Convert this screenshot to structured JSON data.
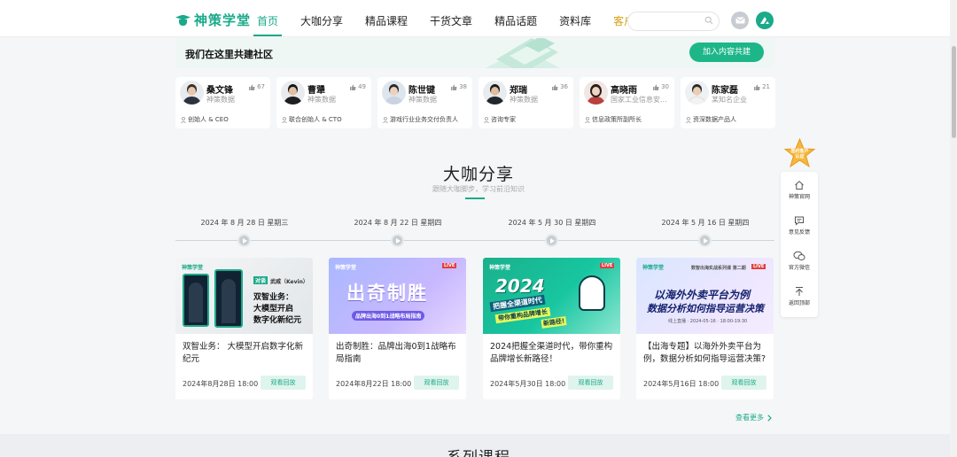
{
  "header": {
    "logo_text": "神策学堂",
    "nav": [
      {
        "label": "首页",
        "active": true
      },
      {
        "label": "大咖分享"
      },
      {
        "label": "精品课程"
      },
      {
        "label": "干货文章"
      },
      {
        "label": "精品话题"
      },
      {
        "label": "资料库"
      },
      {
        "label": "客户专区",
        "vip": true
      }
    ],
    "search_placeholder": ""
  },
  "community": {
    "title": "我们在这里共建社区",
    "join_label": "加入内容共建"
  },
  "members": [
    {
      "name": "桑文锋",
      "likes": "67",
      "org": "神策数据",
      "role": "创始人 & CEO"
    },
    {
      "name": "曹犟",
      "likes": "49",
      "org": "神策数据",
      "role": "联合创始人 & CTO"
    },
    {
      "name": "陈世键",
      "likes": "38",
      "org": "神策数据",
      "role": "游戏行业业务交付负责人"
    },
    {
      "name": "郑瑞",
      "likes": "36",
      "org": "神策数据",
      "role": "咨询专家"
    },
    {
      "name": "高晓雨",
      "likes": "30",
      "org": "国家工业信息安...",
      "role": "信息政策所副所长"
    },
    {
      "name": "陈家磊",
      "likes": "21",
      "org": "某知名企业",
      "role": "资深数据产品人"
    }
  ],
  "section": {
    "title": "大咖分享",
    "subtitle": "跟随大咖脚步，学习前沿知识"
  },
  "timeline": [
    "2024 年 8 月 28 日 星期三",
    "2024 年 8 月 22 日 星期四",
    "2024 年 5 月 30 日 星期四",
    "2024 年 5 月 16 日 星期四"
  ],
  "events": [
    {
      "title": "双智业务： 大模型开启数字化新纪元",
      "date": "2024年8月28日 18:00",
      "watch": "观看回放",
      "thumb": {
        "logo": "神策学堂",
        "badge": "对谈",
        "speaker": "武威（Kevin）",
        "line1": "双智业务：",
        "line2": "大模型开启",
        "line3": "数字化新纪元"
      }
    },
    {
      "title": "出奇制胜：品牌出海0到1战略布局指南",
      "date": "2024年8月22日 18:00",
      "watch": "观看回放",
      "thumb": {
        "logo": "神策学堂",
        "badge": "LIVE",
        "line1": "出奇制胜",
        "line2": "品牌出海0到1战略布局指南"
      }
    },
    {
      "title": "2024把握全渠道时代，带你重构品牌增长新路径！",
      "date": "2024年5月30日 18:00",
      "watch": "观看回放",
      "thumb": {
        "logo": "神策学堂",
        "badge": "LIVE",
        "year": "2024",
        "line1": "把握全渠道时代",
        "line2": "带你重构品牌增长",
        "line3": "新路径!"
      }
    },
    {
      "title": "【出海专题】以海外外卖平台为例，数据分析如何指导运营决策?",
      "date": "2024年5月16日 18:00",
      "watch": "观看回放",
      "thumb": {
        "logo": "神策学堂",
        "series": "数智出海实战系列课 第二期",
        "badge": "LIVE",
        "line1": "以海外外卖平台为例",
        "line2": "数据分析如何指导运营决策",
        "line3": "线上直播 · 2024-05-16 · 18:00-19:30"
      }
    }
  ],
  "more_label": "查看更多",
  "next_section_title": "系列课程",
  "side_panel": {
    "badge_text": "签约客户认证",
    "items": [
      {
        "label": "神策官网",
        "icon": "home-icon"
      },
      {
        "label": "意见反馈",
        "icon": "feedback-icon"
      },
      {
        "label": "官方微信",
        "icon": "wechat-icon"
      },
      {
        "label": "返回顶部",
        "icon": "back-to-top-icon"
      }
    ]
  },
  "colors": {
    "brand": "#1aaa8a",
    "vip": "#d4a017"
  }
}
